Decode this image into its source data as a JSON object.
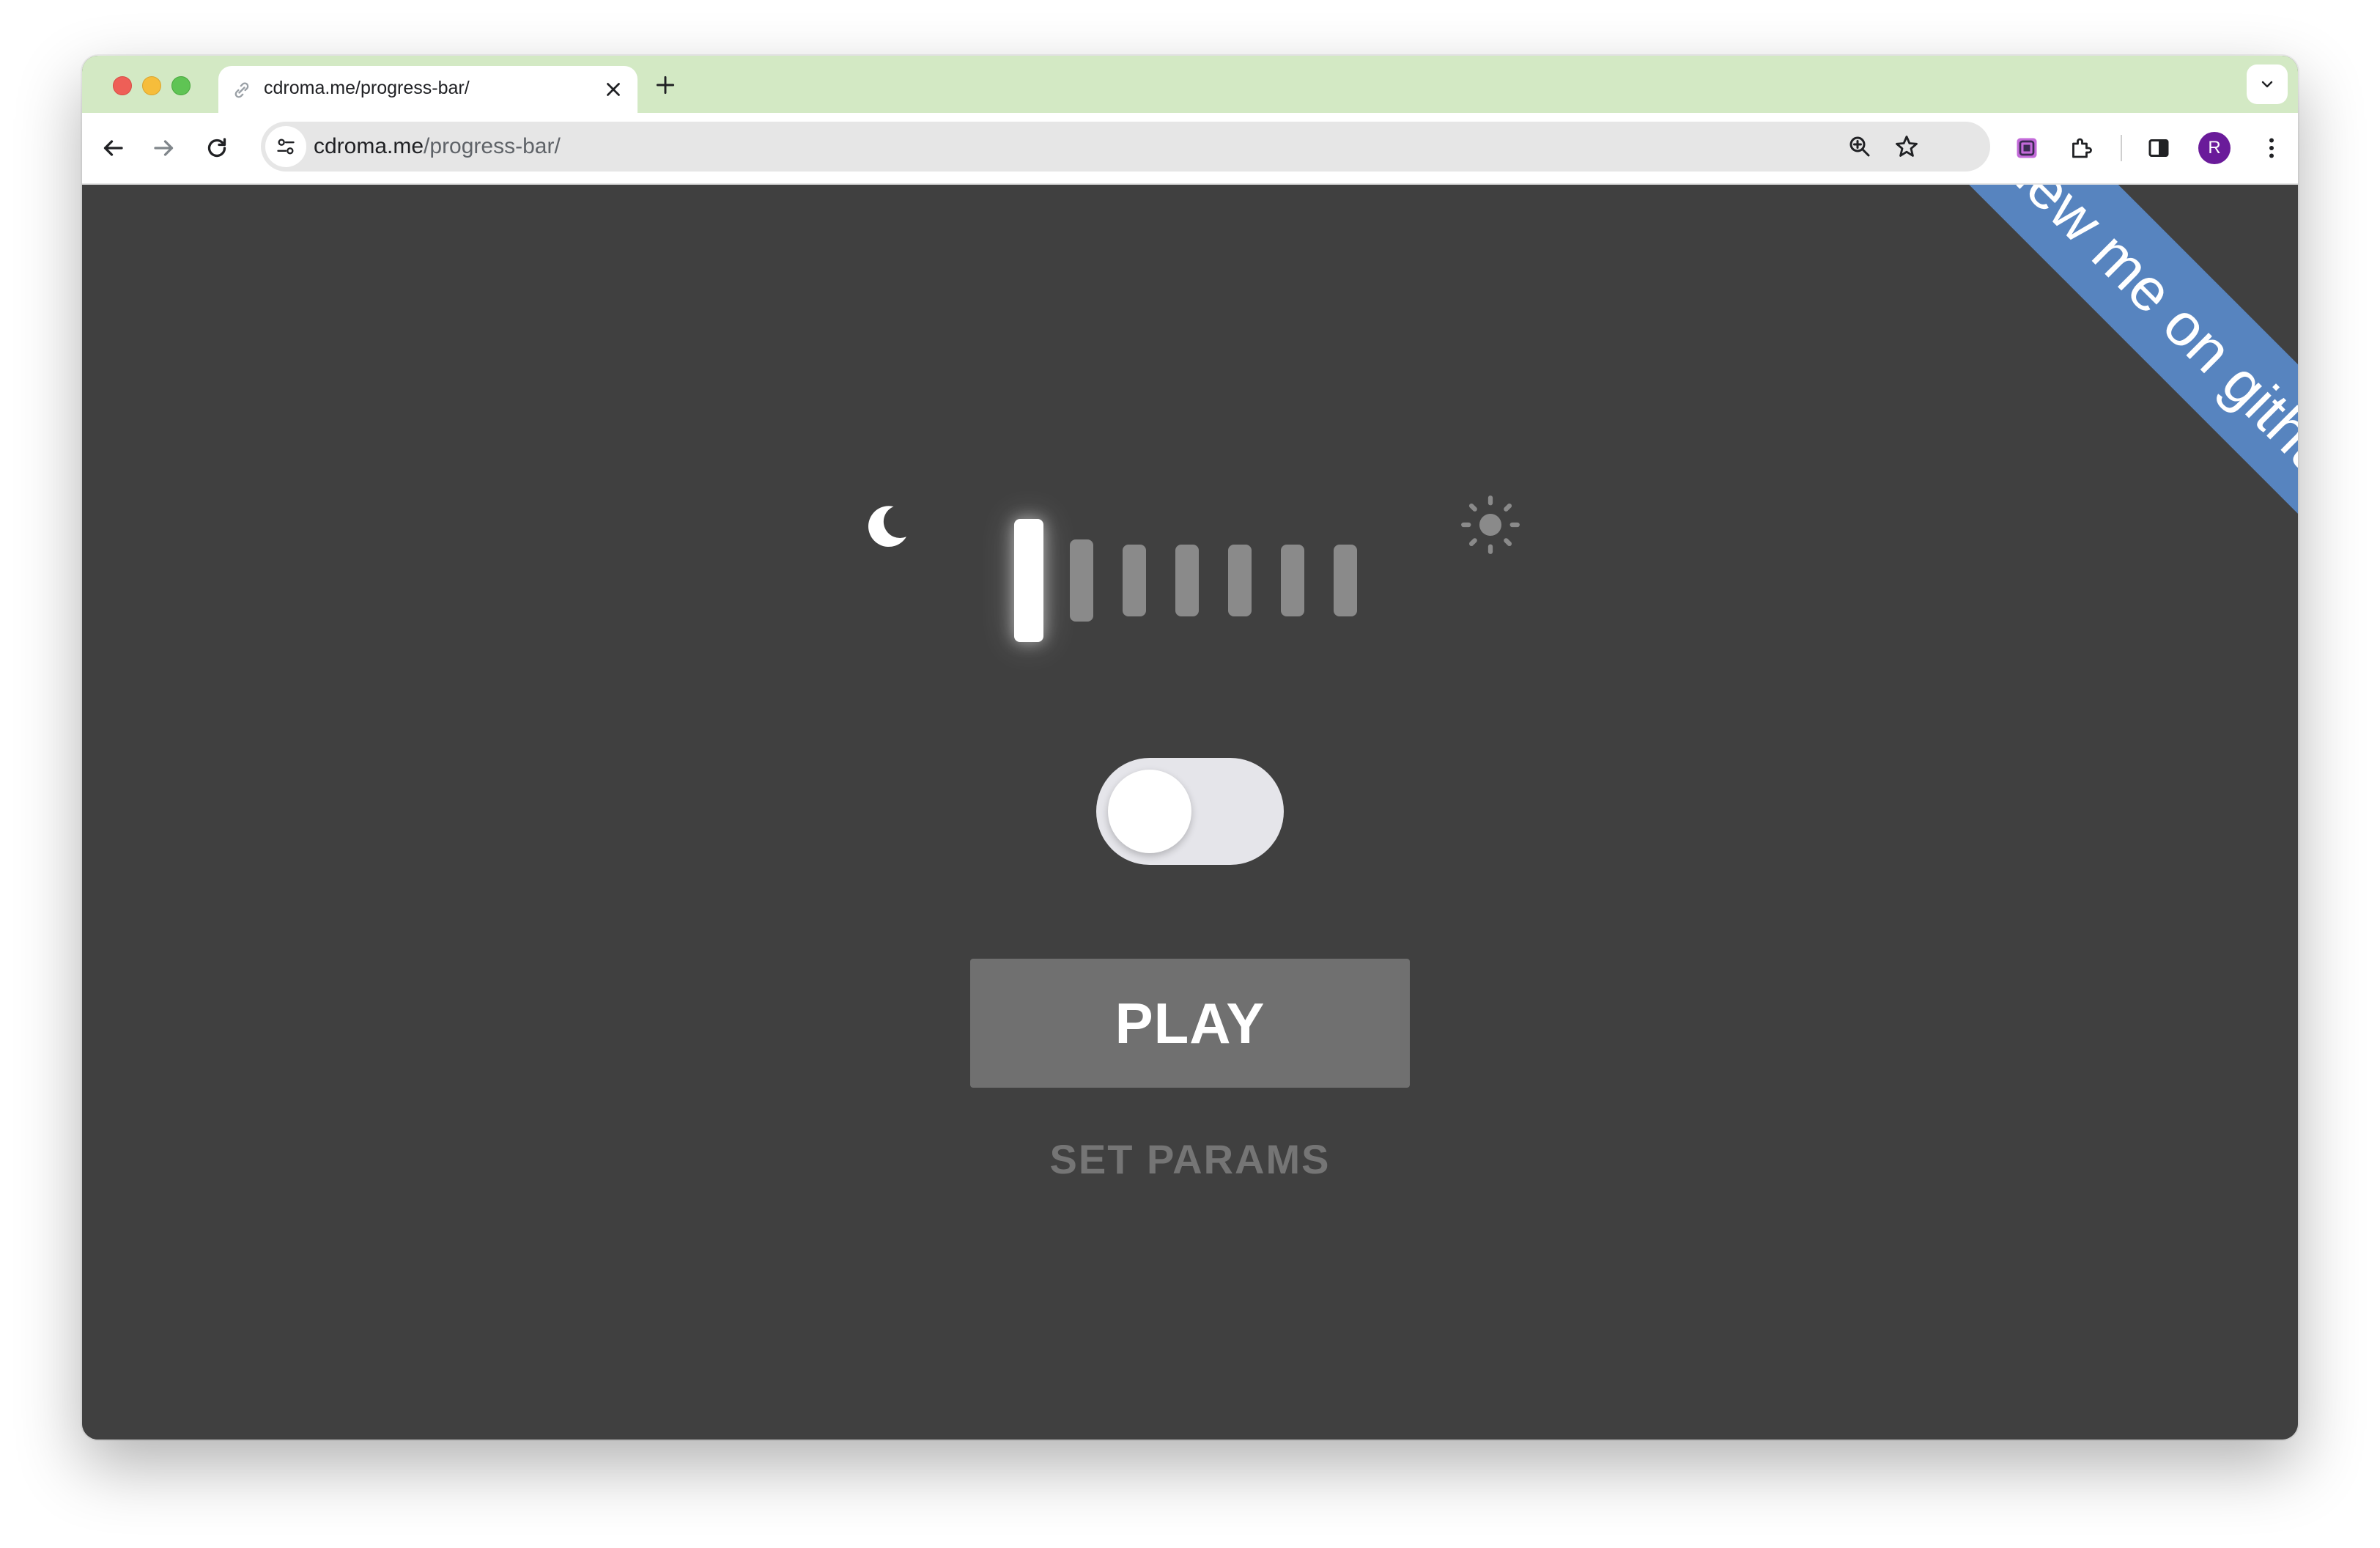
{
  "browser": {
    "tab": {
      "title": "cdroma.me/progress-bar/",
      "favicon": "link-icon"
    },
    "address_bar": {
      "domain": "cdroma.me",
      "path": "/progress-bar/"
    },
    "profile_initial": "R",
    "tabstrip_color": "#d3e9c4",
    "avatar_color": "#6a1b9a"
  },
  "page": {
    "background": "#404040",
    "ribbon": {
      "label": "View me on github",
      "color": "#5784bf"
    },
    "brightness": {
      "left_icon": "moon-icon",
      "right_icon": "sun-icon",
      "segments_total": 7,
      "segments_active": 1
    },
    "toggle": {
      "state": "off"
    },
    "play_button_label": "PLAY",
    "params_link_label": "SET PARAMS"
  }
}
